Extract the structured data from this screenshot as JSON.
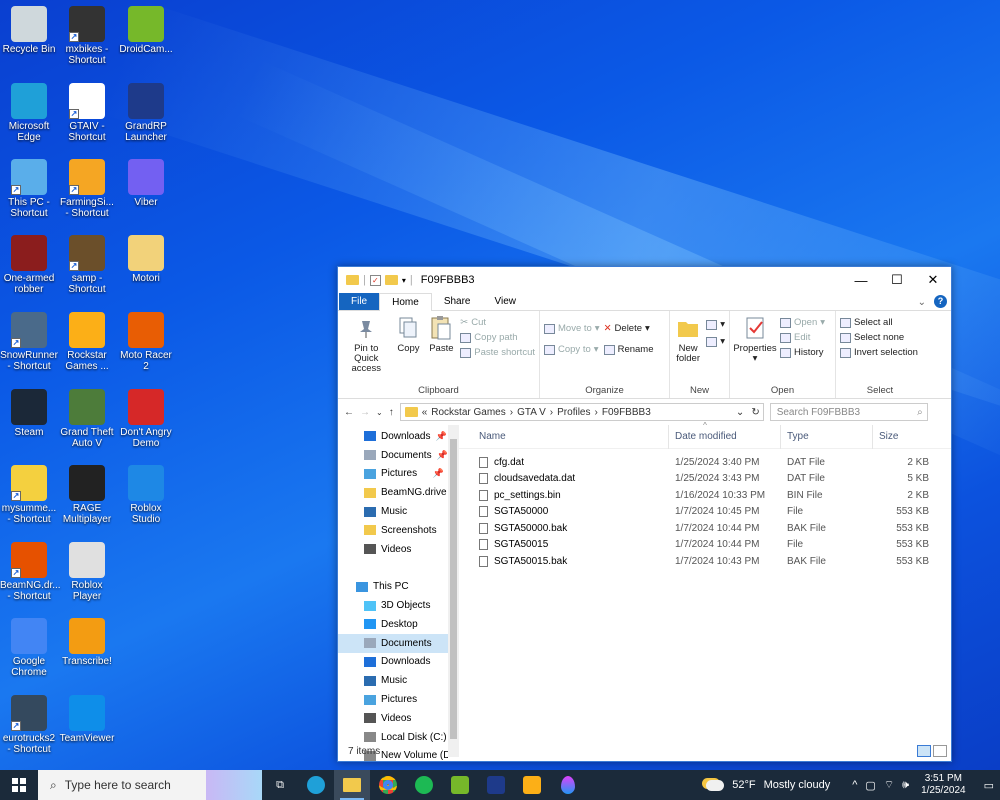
{
  "desktop": {
    "icons": [
      {
        "label": "Recycle Bin",
        "icon": "recycle-bin-icon",
        "color": "#cfd8dc"
      },
      {
        "label": "mxbikes - Shortcut",
        "icon": "tire-icon",
        "color": "#333333"
      },
      {
        "label": "DroidCam...",
        "icon": "android-icon",
        "color": "#76b82a"
      },
      {
        "label": "Microsoft Edge",
        "icon": "edge-icon",
        "color": "#1fa0d8"
      },
      {
        "label": "GTAIV - Shortcut",
        "icon": "gtaiv-icon",
        "color": "#ffffff"
      },
      {
        "label": "GrandRP Launcher",
        "icon": "grandrp-icon",
        "color": "#1e3a8a"
      },
      {
        "label": "This PC - Shortcut",
        "icon": "monitor-icon",
        "color": "#5aaeea"
      },
      {
        "label": "FarmingSi... - Shortcut",
        "icon": "farming-sim-icon",
        "color": "#f5a623"
      },
      {
        "label": "Viber",
        "icon": "viber-icon",
        "color": "#7360f2"
      },
      {
        "label": "One-armed robber",
        "icon": "slot-icon",
        "color": "#8b1d1d"
      },
      {
        "label": "samp - Shortcut",
        "icon": "samp-icon",
        "color": "#6b4f2a"
      },
      {
        "label": "Motori",
        "icon": "folder-icon",
        "color": "#f2d27a"
      },
      {
        "label": "SnowRunner - Shortcut",
        "icon": "snowrunner-icon",
        "color": "#4a6a8a"
      },
      {
        "label": "Rockstar Games ...",
        "icon": "rockstar-icon",
        "color": "#fcaf17"
      },
      {
        "label": "Moto Racer 2",
        "icon": "moto-racer-icon",
        "color": "#e85d04"
      },
      {
        "label": "Steam",
        "icon": "steam-icon",
        "color": "#1b2838"
      },
      {
        "label": "Grand Theft Auto V",
        "icon": "gtav-icon",
        "color": "#4d7c3a"
      },
      {
        "label": "Don't Angry Demo",
        "icon": "angry-bird-icon",
        "color": "#d62828"
      },
      {
        "label": "mysumme... - Shortcut",
        "icon": "summer-car-icon",
        "color": "#f4d03f"
      },
      {
        "label": "RAGE Multiplayer",
        "icon": "rage-mp-icon",
        "color": "#222222"
      },
      {
        "label": "Roblox Studio",
        "icon": "roblox-studio-icon",
        "color": "#1e88e5"
      },
      {
        "label": "BeamNG.dr... - Shortcut",
        "icon": "beamng-icon",
        "color": "#e65100"
      },
      {
        "label": "Roblox Player",
        "icon": "roblox-icon",
        "color": "#e0e0e0"
      },
      {
        "label": "Google Chrome",
        "icon": "chrome-icon",
        "color": "#4285f4"
      },
      {
        "label": "Transcribe!",
        "icon": "transcribe-icon",
        "color": "#f39c12"
      },
      {
        "label": "eurotrucks2 - Shortcut",
        "icon": "eurotruck-icon",
        "color": "#34495e"
      },
      {
        "label": "TeamViewer",
        "icon": "teamviewer-icon",
        "color": "#0e8ee9"
      }
    ]
  },
  "explorer": {
    "title": "F09FBBB3",
    "tabs": [
      "File",
      "Home",
      "Share",
      "View"
    ],
    "ribbon": {
      "clipboard": {
        "label": "Clipboard",
        "pin": "Pin to Quick access",
        "copy": "Copy",
        "paste": "Paste",
        "cut": "Cut",
        "copy_path": "Copy path",
        "paste_shortcut": "Paste shortcut"
      },
      "organize": {
        "label": "Organize",
        "move_to": "Move to",
        "copy_to": "Copy to",
        "delete": "Delete",
        "rename": "Rename"
      },
      "new": {
        "label": "New",
        "new_folder": "New folder"
      },
      "open": {
        "label": "Open",
        "properties": "Properties",
        "open": "Open",
        "edit": "Edit",
        "history": "History"
      },
      "select": {
        "label": "Select",
        "select_all": "Select all",
        "select_none": "Select none",
        "invert": "Invert selection"
      }
    },
    "address": {
      "prefix": "«",
      "crumbs": [
        "Rockstar Games",
        "GTA V",
        "Profiles",
        "F09FBBB3"
      ],
      "search_placeholder": "Search F09FBBB3"
    },
    "nav": [
      {
        "label": "Downloads",
        "icon": "download-icon",
        "pinned": true
      },
      {
        "label": "Documents",
        "icon": "documents-icon",
        "pinned": true
      },
      {
        "label": "Pictures",
        "icon": "pictures-icon",
        "pinned": true
      },
      {
        "label": "BeamNG.drive",
        "icon": "folder-icon",
        "pinned": false
      },
      {
        "label": "Music",
        "icon": "music-icon",
        "pinned": false
      },
      {
        "label": "Screenshots",
        "icon": "folder-icon",
        "pinned": false
      },
      {
        "label": "Videos",
        "icon": "videos-icon",
        "pinned": false
      },
      {
        "label": "",
        "icon": "",
        "pinned": false
      },
      {
        "label": "This PC",
        "icon": "this-pc-icon",
        "pinned": false
      },
      {
        "label": "3D Objects",
        "icon": "3d-objects-icon",
        "pinned": false
      },
      {
        "label": "Desktop",
        "icon": "desktop-icon",
        "pinned": false
      },
      {
        "label": "Documents",
        "icon": "documents-icon",
        "pinned": false,
        "selected": true
      },
      {
        "label": "Downloads",
        "icon": "download-icon",
        "pinned": false
      },
      {
        "label": "Music",
        "icon": "music-icon",
        "pinned": false
      },
      {
        "label": "Pictures",
        "icon": "pictures-icon",
        "pinned": false
      },
      {
        "label": "Videos",
        "icon": "videos-icon",
        "pinned": false
      },
      {
        "label": "Local Disk (C:)",
        "icon": "drive-icon",
        "pinned": false
      },
      {
        "label": "New Volume (D:",
        "icon": "drive-icon",
        "pinned": false
      }
    ],
    "columns": [
      "Name",
      "Date modified",
      "Type",
      "Size"
    ],
    "files": [
      [
        "cfg.dat",
        "1/25/2024 3:40 PM",
        "DAT File",
        "2 KB"
      ],
      [
        "cloudsavedata.dat",
        "1/25/2024 3:43 PM",
        "DAT File",
        "5 KB"
      ],
      [
        "pc_settings.bin",
        "1/16/2024 10:33 PM",
        "BIN File",
        "2 KB"
      ],
      [
        "SGTA50000",
        "1/7/2024 10:45 PM",
        "File",
        "553 KB"
      ],
      [
        "SGTA50000.bak",
        "1/7/2024 10:44 PM",
        "BAK File",
        "553 KB"
      ],
      [
        "SGTA50015",
        "1/7/2024 10:44 PM",
        "File",
        "553 KB"
      ],
      [
        "SGTA50015.bak",
        "1/7/2024 10:43 PM",
        "BAK File",
        "553 KB"
      ]
    ],
    "status": "7 items"
  },
  "taskbar": {
    "search_placeholder": "Type here to search",
    "weather": {
      "temp": "52°F",
      "desc": "Mostly cloudy"
    },
    "time": "3:51 PM",
    "date": "1/25/2024"
  }
}
